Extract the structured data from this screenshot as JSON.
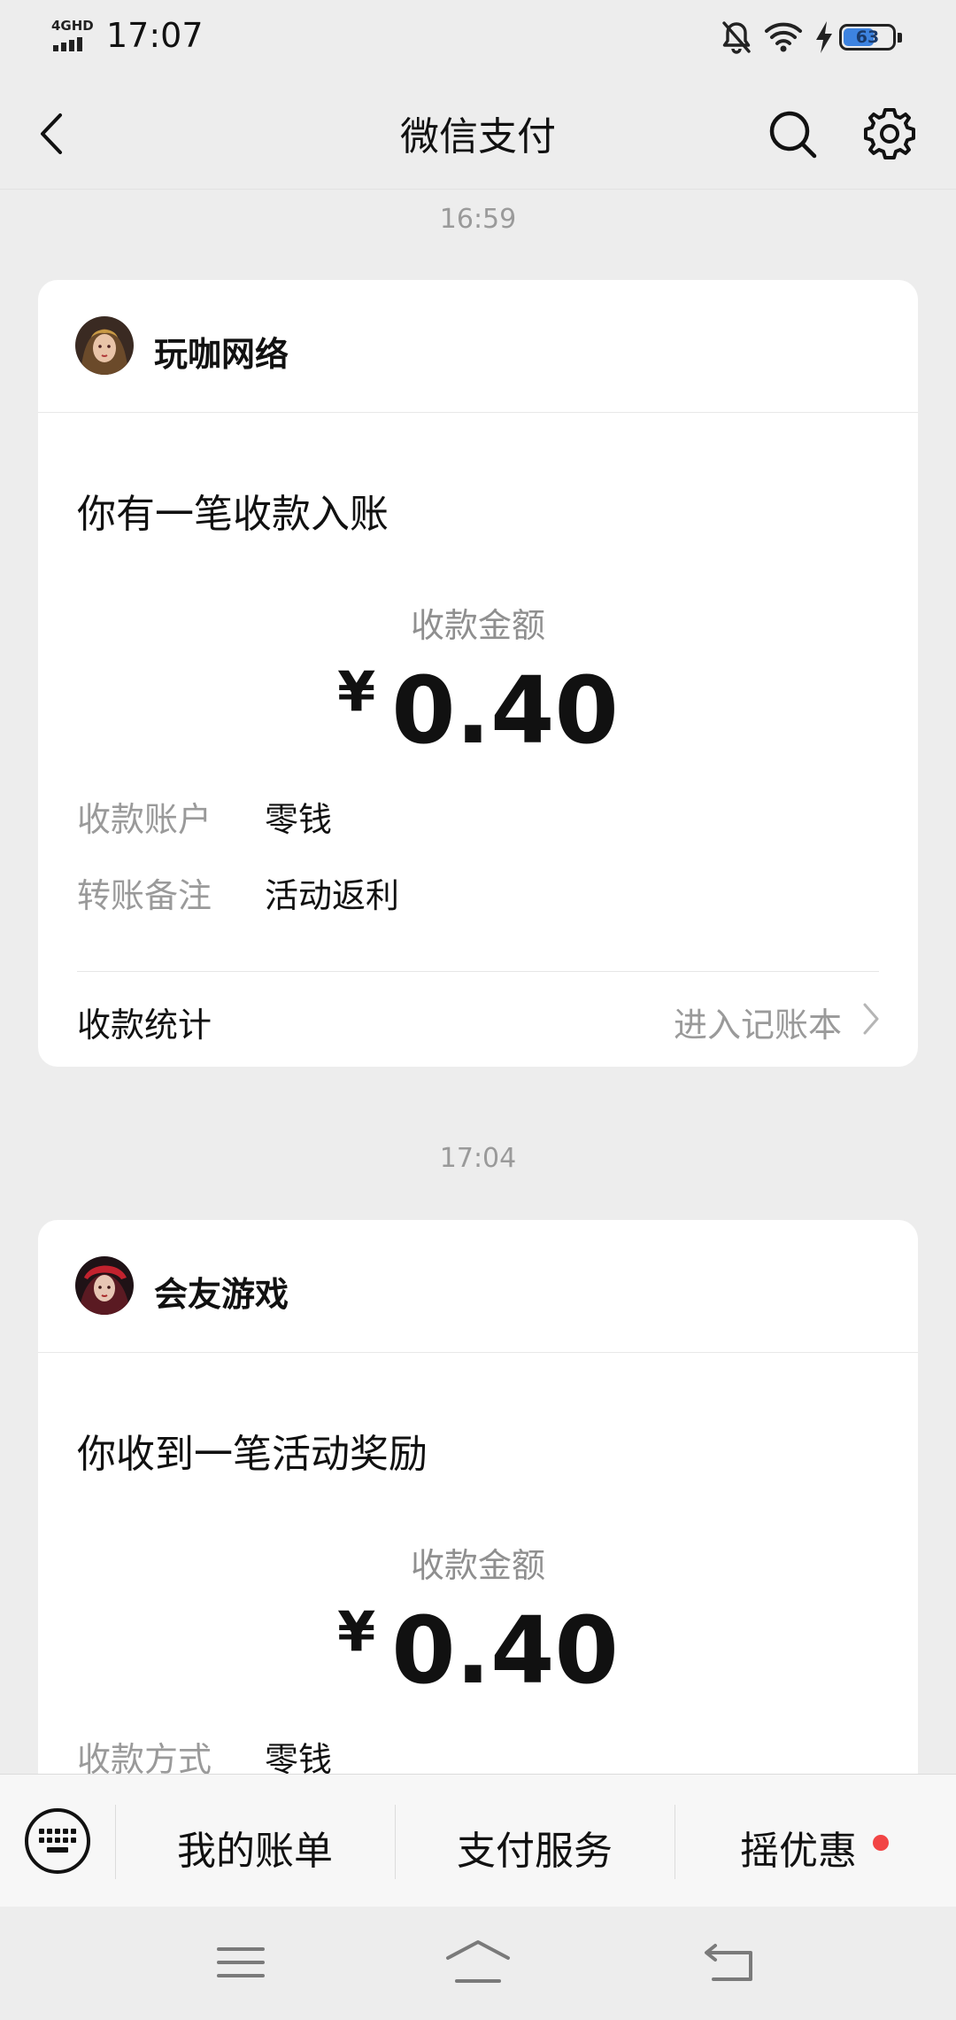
{
  "status_bar": {
    "network": "4GHD",
    "time": "17:07",
    "battery": "63",
    "battery_level": 0.63
  },
  "nav": {
    "title": "微信支付"
  },
  "messages": [
    {
      "timestamp": "16:59",
      "merchant": "玩咖网络",
      "headline": "你有一笔收款入账",
      "amount_label": "收款金额",
      "currency": "¥",
      "amount": "0.40",
      "rows": [
        {
          "label": "收款账户",
          "value": "零钱"
        },
        {
          "label": "转账备注",
          "value": "活动返利"
        }
      ],
      "footer_left": "收款统计",
      "footer_right": "进入记账本"
    },
    {
      "timestamp": "17:04",
      "merchant": "会友游戏",
      "headline": "你收到一笔活动奖励",
      "amount_label": "收款金额",
      "currency": "¥",
      "amount": "0.40",
      "rows": [
        {
          "label": "收款方式",
          "value": "零钱"
        }
      ]
    }
  ],
  "menu": {
    "items": [
      "我的账单",
      "支付服务",
      "摇优惠"
    ]
  },
  "icons": {
    "back": "chevron-left-icon",
    "search": "search-icon",
    "settings": "gear-icon",
    "keyboard": "keyboard-icon",
    "nav_menu": "menu-icon",
    "nav_home": "home-icon",
    "nav_back": "back-icon"
  },
  "colors": {
    "battery_fill": "#3d83e0",
    "badge": "#f24545",
    "background": "#ededed"
  }
}
